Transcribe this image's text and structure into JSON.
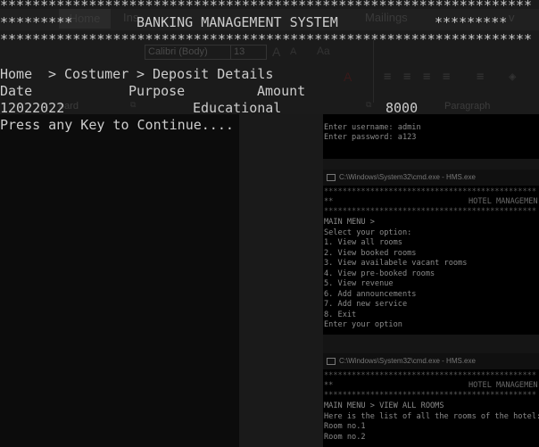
{
  "console": {
    "stars": "******************************************************************",
    "header_left": "*********",
    "system_title": "BANKING MANAGEMENT SYSTEM",
    "header_right": "*********",
    "breadcrumb": {
      "home": "Home",
      "sep": ">",
      "section": "Costumer",
      "page": "Deposit Details"
    },
    "table": {
      "headers": [
        "Date",
        "Purpose",
        "Amount"
      ],
      "rows": [
        {
          "date": "12022022",
          "purpose": "Educational",
          "amount": "8000"
        }
      ]
    },
    "prompt": "Press any Key to Continue...."
  },
  "background": {
    "ribbon_tabs": [
      "Home",
      "Ins",
      "Mailings",
      "v"
    ],
    "font_name": "Calibri (Body)",
    "font_size": "13",
    "labels": [
      "oard",
      "Paragraph"
    ],
    "login_window": {
      "lines": [
        "Enter username: admin",
        "Enter password: a123"
      ]
    },
    "menu_window": {
      "title": "C:\\Windows\\System32\\cmd.exe - HMS.exe",
      "stars": "**********************************************",
      "hdr_left": "**",
      "hdr_right": "HOTEL MANAGEMEN",
      "lines": [
        "MAIN MENU >",
        "Select your option:",
        "1. View all rooms",
        "2. View booked rooms",
        "3. View availabele vacant rooms",
        "4. View pre-booked rooms",
        "5. View revenue",
        "6. Add announcements",
        "7. Add new service",
        "8. Exit",
        "Enter your option"
      ]
    },
    "rooms_window": {
      "title": "C:\\Windows\\System32\\cmd.exe - HMS.exe",
      "stars": "**********************************************",
      "hdr_left": "**",
      "hdr_right": "HOTEL MANAGEMEN",
      "lines": [
        "MAIN MENU > VIEW ALL ROOMS",
        "Here is the list of all the rooms of the hotel:",
        "Room no.1",
        "Room no.2"
      ]
    }
  }
}
